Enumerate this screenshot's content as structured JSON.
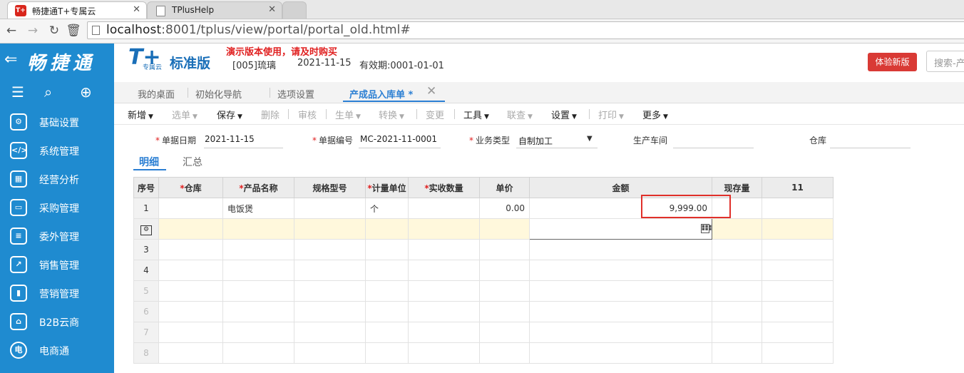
{
  "browser": {
    "tabs": [
      {
        "label": "畅捷通T+专属云",
        "active": true
      },
      {
        "label": "TPlusHelp",
        "active": false
      }
    ],
    "url_host": "localhost",
    "url_rest": ":8001/tplus/view/portal/portal_old.html#"
  },
  "sidebar": {
    "brand": "畅捷通",
    "items": [
      {
        "label": "基础设置",
        "icon": "settings-icon"
      },
      {
        "label": "系统管理",
        "icon": "code-monitor-icon"
      },
      {
        "label": "经营分析",
        "icon": "analysis-icon"
      },
      {
        "label": "采购管理",
        "icon": "purchase-icon"
      },
      {
        "label": "委外管理",
        "icon": "outsource-icon"
      },
      {
        "label": "销售管理",
        "icon": "sales-chart-icon"
      },
      {
        "label": "营销管理",
        "icon": "marketing-icon"
      },
      {
        "label": "B2B云商",
        "icon": "b2b-icon"
      },
      {
        "label": "电商通",
        "icon": "ecommerce-icon"
      }
    ]
  },
  "header": {
    "logo_mark": "T+",
    "logo_sub": "专属云",
    "edition": "标准版",
    "demo_note": "演示版本使用，请及时购买",
    "account": "[005]琉璃",
    "date": "2021-11-15",
    "validity": "有效期:0001-01-01",
    "try_new": "体验新版",
    "search_placeholder": "搜索-产"
  },
  "page_tabs": [
    {
      "label": "我的桌面"
    },
    {
      "label": "初始化导航"
    },
    {
      "label": "选项设置"
    },
    {
      "label": "产成品入库单 *"
    }
  ],
  "toolbar": [
    {
      "label": "新增",
      "caret": true,
      "disabled": false
    },
    {
      "label": "选单",
      "caret": true,
      "disabled": true
    },
    {
      "label": "保存",
      "caret": true,
      "disabled": false
    },
    {
      "label": "删除",
      "caret": false,
      "disabled": true
    },
    {
      "label": "审核",
      "caret": false,
      "disabled": true
    },
    {
      "label": "生单",
      "caret": true,
      "disabled": true
    },
    {
      "label": "转换",
      "caret": true,
      "disabled": true
    },
    {
      "label": "变更",
      "caret": false,
      "disabled": true
    },
    {
      "label": "工具",
      "caret": true,
      "disabled": false
    },
    {
      "label": "联查",
      "caret": true,
      "disabled": true
    },
    {
      "label": "设置",
      "caret": true,
      "disabled": false
    },
    {
      "label": "打印",
      "caret": true,
      "disabled": true
    },
    {
      "label": "更多",
      "caret": true,
      "disabled": false
    }
  ],
  "form": {
    "doc_date_label": "单据日期",
    "doc_date": "2021-11-15",
    "doc_no_label": "单据编号",
    "doc_no": "MC-2021-11-0001",
    "biz_type_label": "业务类型",
    "biz_type": "自制加工",
    "workshop_label": "生产车间",
    "warehouse_label": "仓库"
  },
  "sub_tabs": [
    "明细",
    "汇总"
  ],
  "grid": {
    "headers": [
      "序号",
      "仓库",
      "产品名称",
      "规格型号",
      "计量单位",
      "实收数量",
      "单价",
      "金额",
      "现存量",
      "11"
    ],
    "required": [
      false,
      true,
      true,
      false,
      true,
      true,
      false,
      false,
      false,
      false
    ],
    "row1": {
      "no": "1",
      "product": "电饭煲",
      "unit": "个",
      "price": "0.00",
      "amount": "9,999.00"
    },
    "row_numbers": [
      "3",
      "4",
      "5",
      "6",
      "7",
      "8"
    ]
  }
}
